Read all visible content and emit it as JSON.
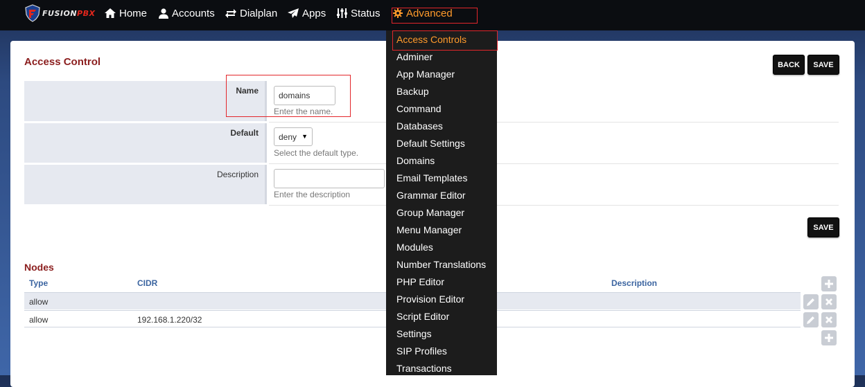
{
  "nav": {
    "brand": "FUSIONPBX",
    "brand_a": "FUSION",
    "brand_b": "PBX",
    "items": [
      {
        "label": "Home",
        "icon": "home-icon"
      },
      {
        "label": "Accounts",
        "icon": "user-icon"
      },
      {
        "label": "Dialplan",
        "icon": "swap-arrows-icon"
      },
      {
        "label": "Apps",
        "icon": "paper-plane-icon"
      },
      {
        "label": "Status",
        "icon": "equalizer-icon"
      },
      {
        "label": "Advanced",
        "icon": "gear-icon"
      }
    ],
    "active": "Advanced"
  },
  "page": {
    "title": "Access Control",
    "back_label": "BACK",
    "save_label": "SAVE",
    "save_label_bottom": "SAVE"
  },
  "form": {
    "name": {
      "label": "Name",
      "value": "domains",
      "hint": "Enter the name."
    },
    "default": {
      "label": "Default",
      "value": "deny",
      "hint": "Select the default type."
    },
    "description": {
      "label": "Description",
      "value": "",
      "hint": "Enter the description"
    }
  },
  "nodes": {
    "title": "Nodes",
    "columns": [
      "Type",
      "CIDR",
      "Description"
    ],
    "rows": [
      {
        "type": "allow",
        "cidr": "",
        "description": ""
      },
      {
        "type": "allow",
        "cidr": "192.168.1.220/32",
        "description": ""
      }
    ]
  },
  "advanced_menu": {
    "items": [
      "Access Controls",
      "Adminer",
      "App Manager",
      "Backup",
      "Command",
      "Databases",
      "Default Settings",
      "Domains",
      "Email Templates",
      "Grammar Editor",
      "Group Manager",
      "Menu Manager",
      "Modules",
      "Number Translations",
      "PHP Editor",
      "Provision Editor",
      "Script Editor",
      "Settings",
      "SIP Profiles",
      "Transactions"
    ],
    "active": "Access Controls"
  },
  "colors": {
    "accent": "#ff9a2b",
    "title_red": "#8b1e1e",
    "header_blue": "#3b64a0",
    "highlight_box": "#e3262b"
  }
}
